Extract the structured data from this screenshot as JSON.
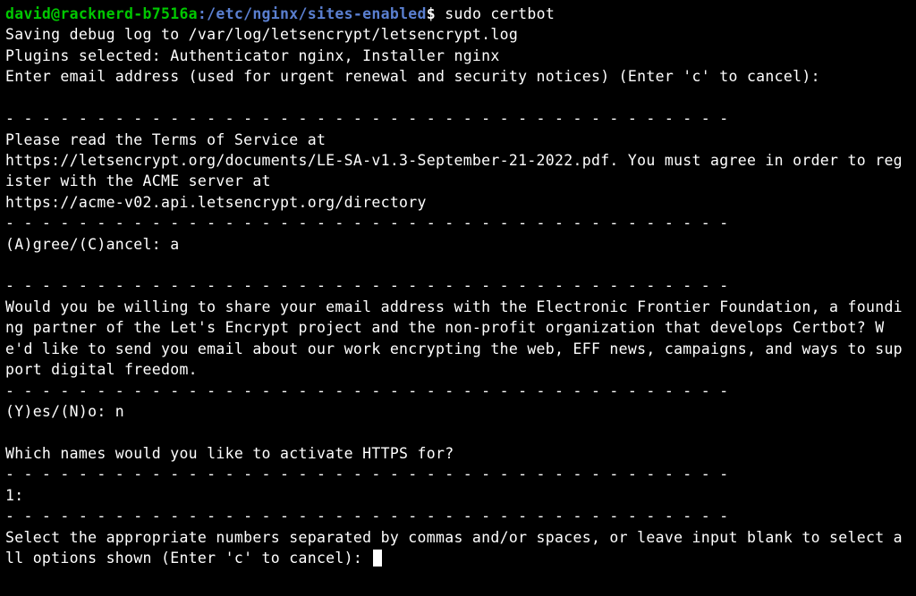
{
  "prompt": {
    "user_host": "david@racknerd-b7516a",
    "path": ":/etc/nginx/sites-enabled",
    "dollar": "$",
    "command": " sudo certbot"
  },
  "lines": {
    "l1": "Saving debug log to /var/log/letsencrypt/letsencrypt.log",
    "l2": "Plugins selected: Authenticator nginx, Installer nginx",
    "l3": "Enter email address (used for urgent renewal and security notices) (Enter 'c' to cancel):",
    "blank": " ",
    "dash": "- - - - - - - - - - - - - - - - - - - - - - - - - - - - - - - - - - - - - - - -",
    "l5": "Please read the Terms of Service at",
    "l6": "https://letsencrypt.org/documents/LE-SA-v1.3-September-21-2022.pdf. You must agree in order to register with the ACME server at",
    "l7": "https://acme-v02.api.letsencrypt.org/directory",
    "l8": "(A)gree/(C)ancel: a",
    "l9": "Would you be willing to share your email address with the Electronic Frontier Foundation, a founding partner of the Let's Encrypt project and the non-profit organization that develops Certbot? We'd like to send you email about our work encrypting the web, EFF news, campaigns, and ways to support digital freedom.",
    "l10": "(Y)es/(N)o: n",
    "l11": "Which names would you like to activate HTTPS for?",
    "l12": "1:",
    "l13": "Select the appropriate numbers separated by commas and/or spaces, or leave input blank to select all options shown (Enter 'c' to cancel): "
  }
}
